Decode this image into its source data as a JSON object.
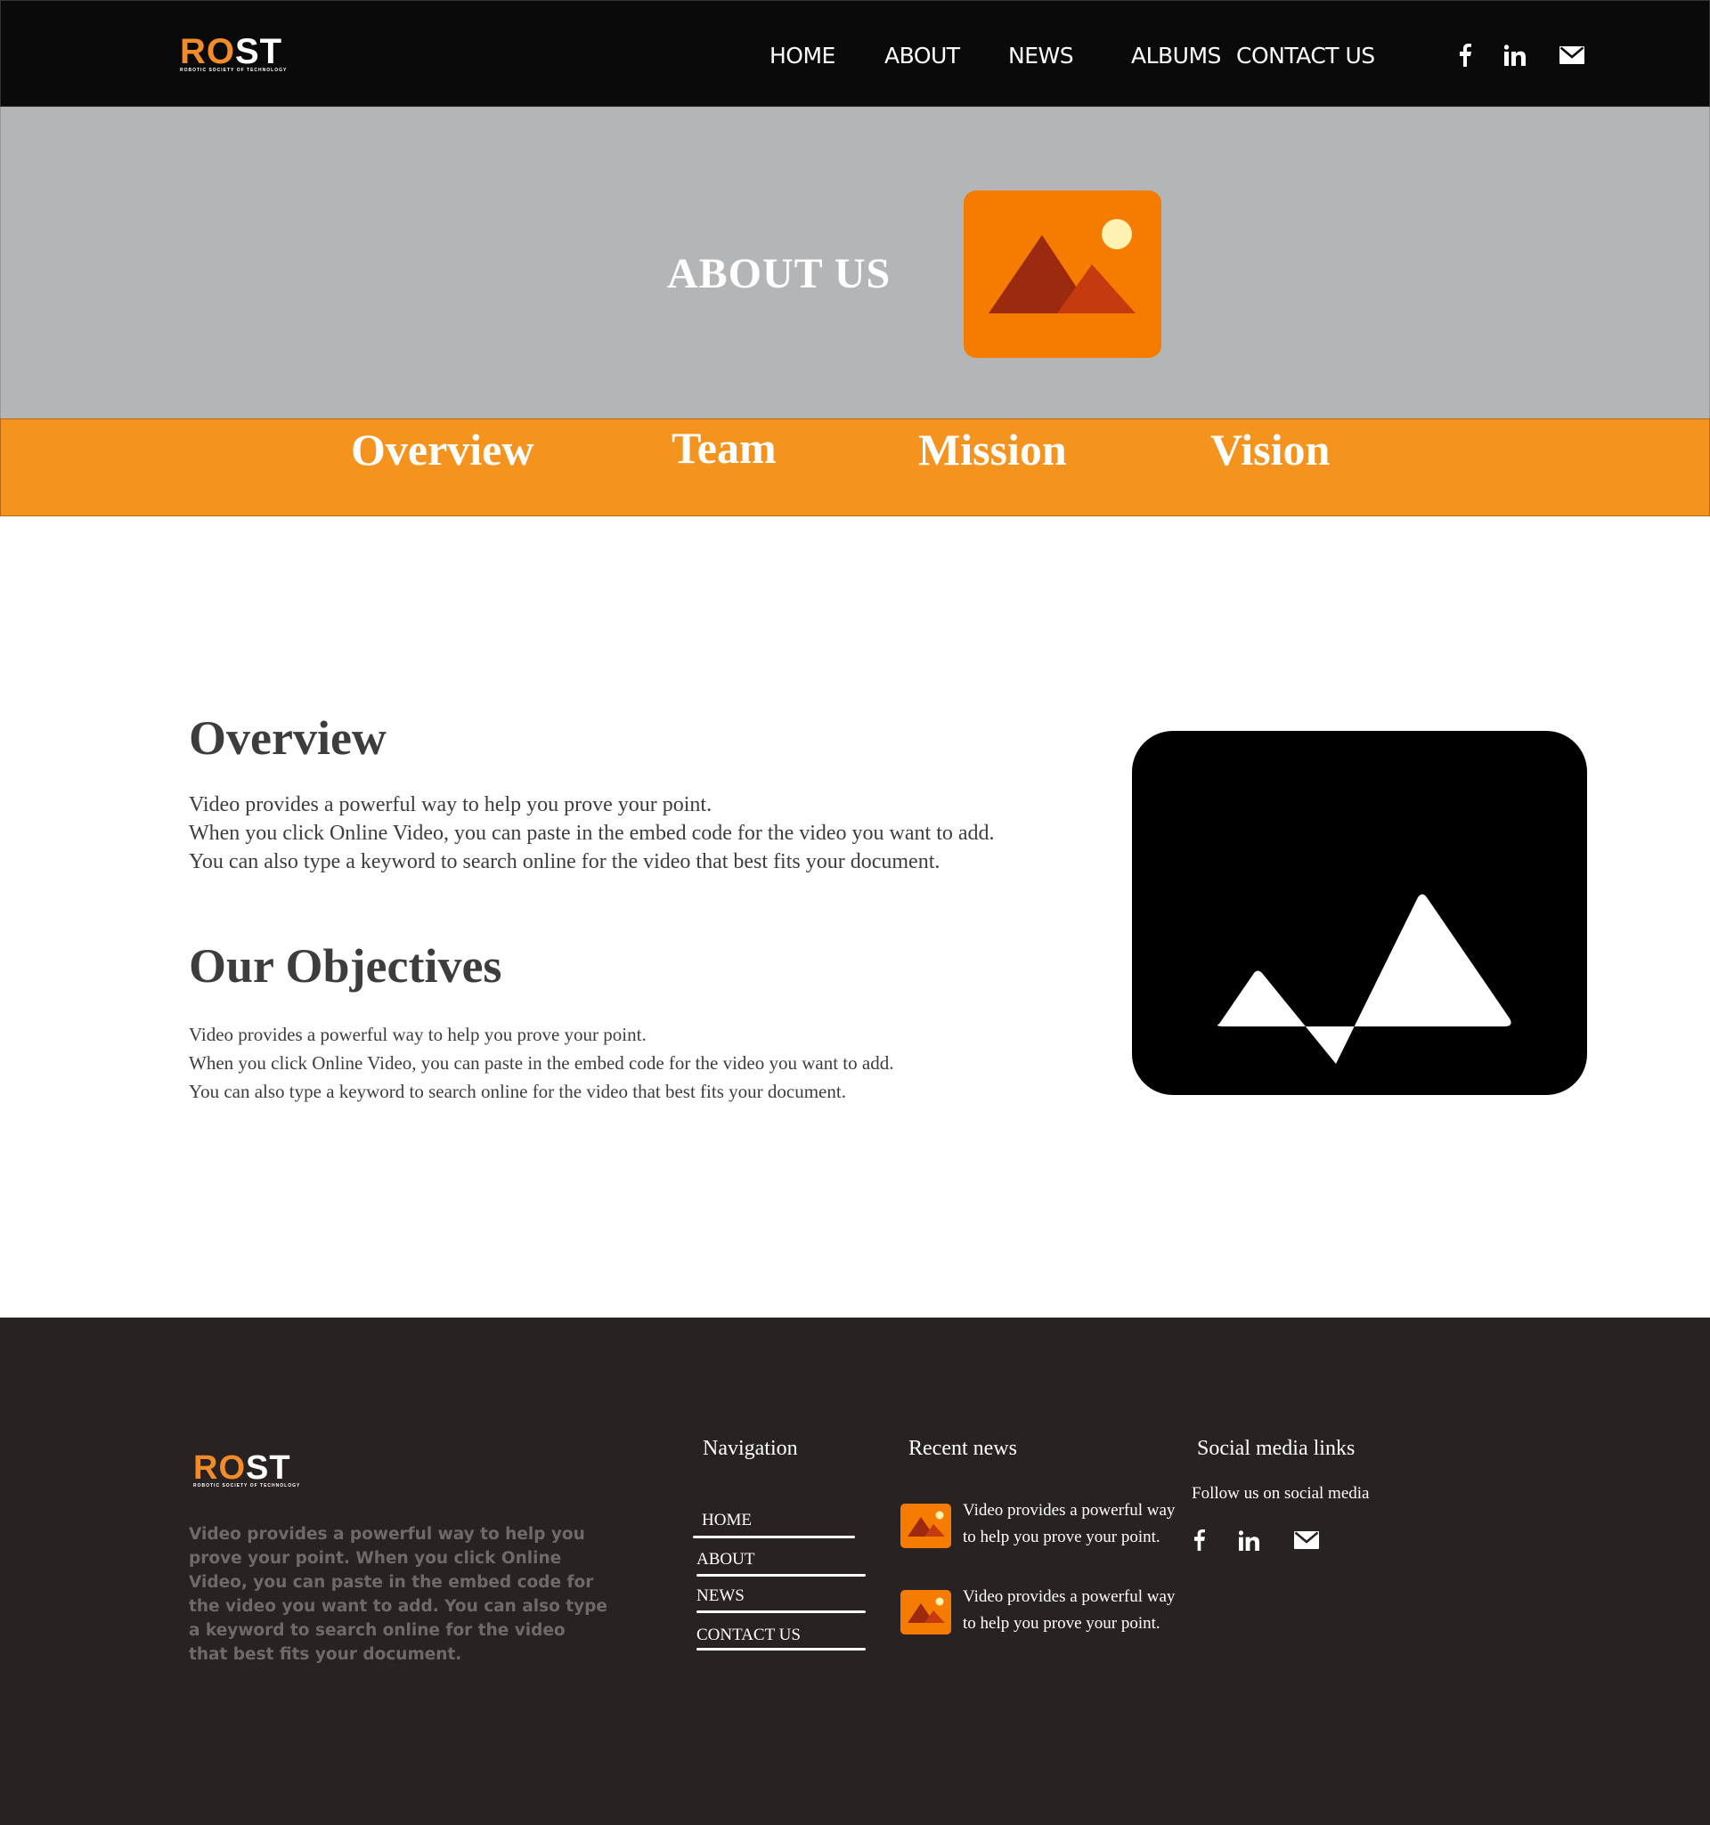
{
  "header": {
    "logo": {
      "mark_orange": "RO",
      "mark_white": "ST",
      "tagline": "ROBOTIC SOCIETY OF TECHNOLOGY"
    },
    "nav": [
      "HOME",
      "ABOUT",
      "NEWS",
      "ALBUMS",
      "CONTACT US"
    ],
    "social_icons": [
      "facebook-icon",
      "linkedin-icon",
      "mail-icon"
    ]
  },
  "hero": {
    "title": "ABOUT US",
    "image_icon": "image-placeholder-icon"
  },
  "tabs": [
    "Overview",
    "Team",
    "Mission",
    "Vision"
  ],
  "main": {
    "overview": {
      "title": "Overview",
      "lines": [
        "Video provides a powerful way to help you prove your point.",
        "When you click Online Video, you can paste in the embed code for the video you want to add.",
        "You can also type a keyword to search online for the video that best fits your document."
      ]
    },
    "objectives": {
      "title": "Our Objectives",
      "lines": [
        "Video provides a powerful way to help you prove your point.",
        "When you click Online Video, you can paste in the embed code for the video you want to add.",
        "You can also type a keyword to search online for the video that best fits your document."
      ]
    },
    "image_icon": "image-placeholder-icon"
  },
  "footer": {
    "logo": {
      "mark_orange": "RO",
      "mark_white": "ST",
      "tagline": "ROBOTIC SOCIETY OF TECHNOLOGY"
    },
    "about": "Video provides a powerful way to help you prove your point. When you click Online Video, you can paste in the embed code for the video you want to add. You can also type a keyword to search online for the video that best fits your document.",
    "navigation": {
      "title": "Navigation",
      "items": [
        "HOME",
        "ABOUT",
        "NEWS",
        "CONTACT US"
      ]
    },
    "recent_news": {
      "title": "Recent news",
      "items": [
        "Video provides a powerful way to help you prove your point.",
        "Video provides a powerful way to help you prove your point."
      ]
    },
    "social": {
      "title": "Social media links",
      "subtitle": "Follow us on social media",
      "icons": [
        "facebook-icon",
        "linkedin-icon",
        "mail-icon"
      ]
    }
  },
  "colors": {
    "header_bg": "#0a0a0a",
    "hero_bg": "#b4b5b7",
    "accent_orange": "#f5931f",
    "footer_bg": "#282223",
    "text_dark": "#3d3d3d"
  }
}
